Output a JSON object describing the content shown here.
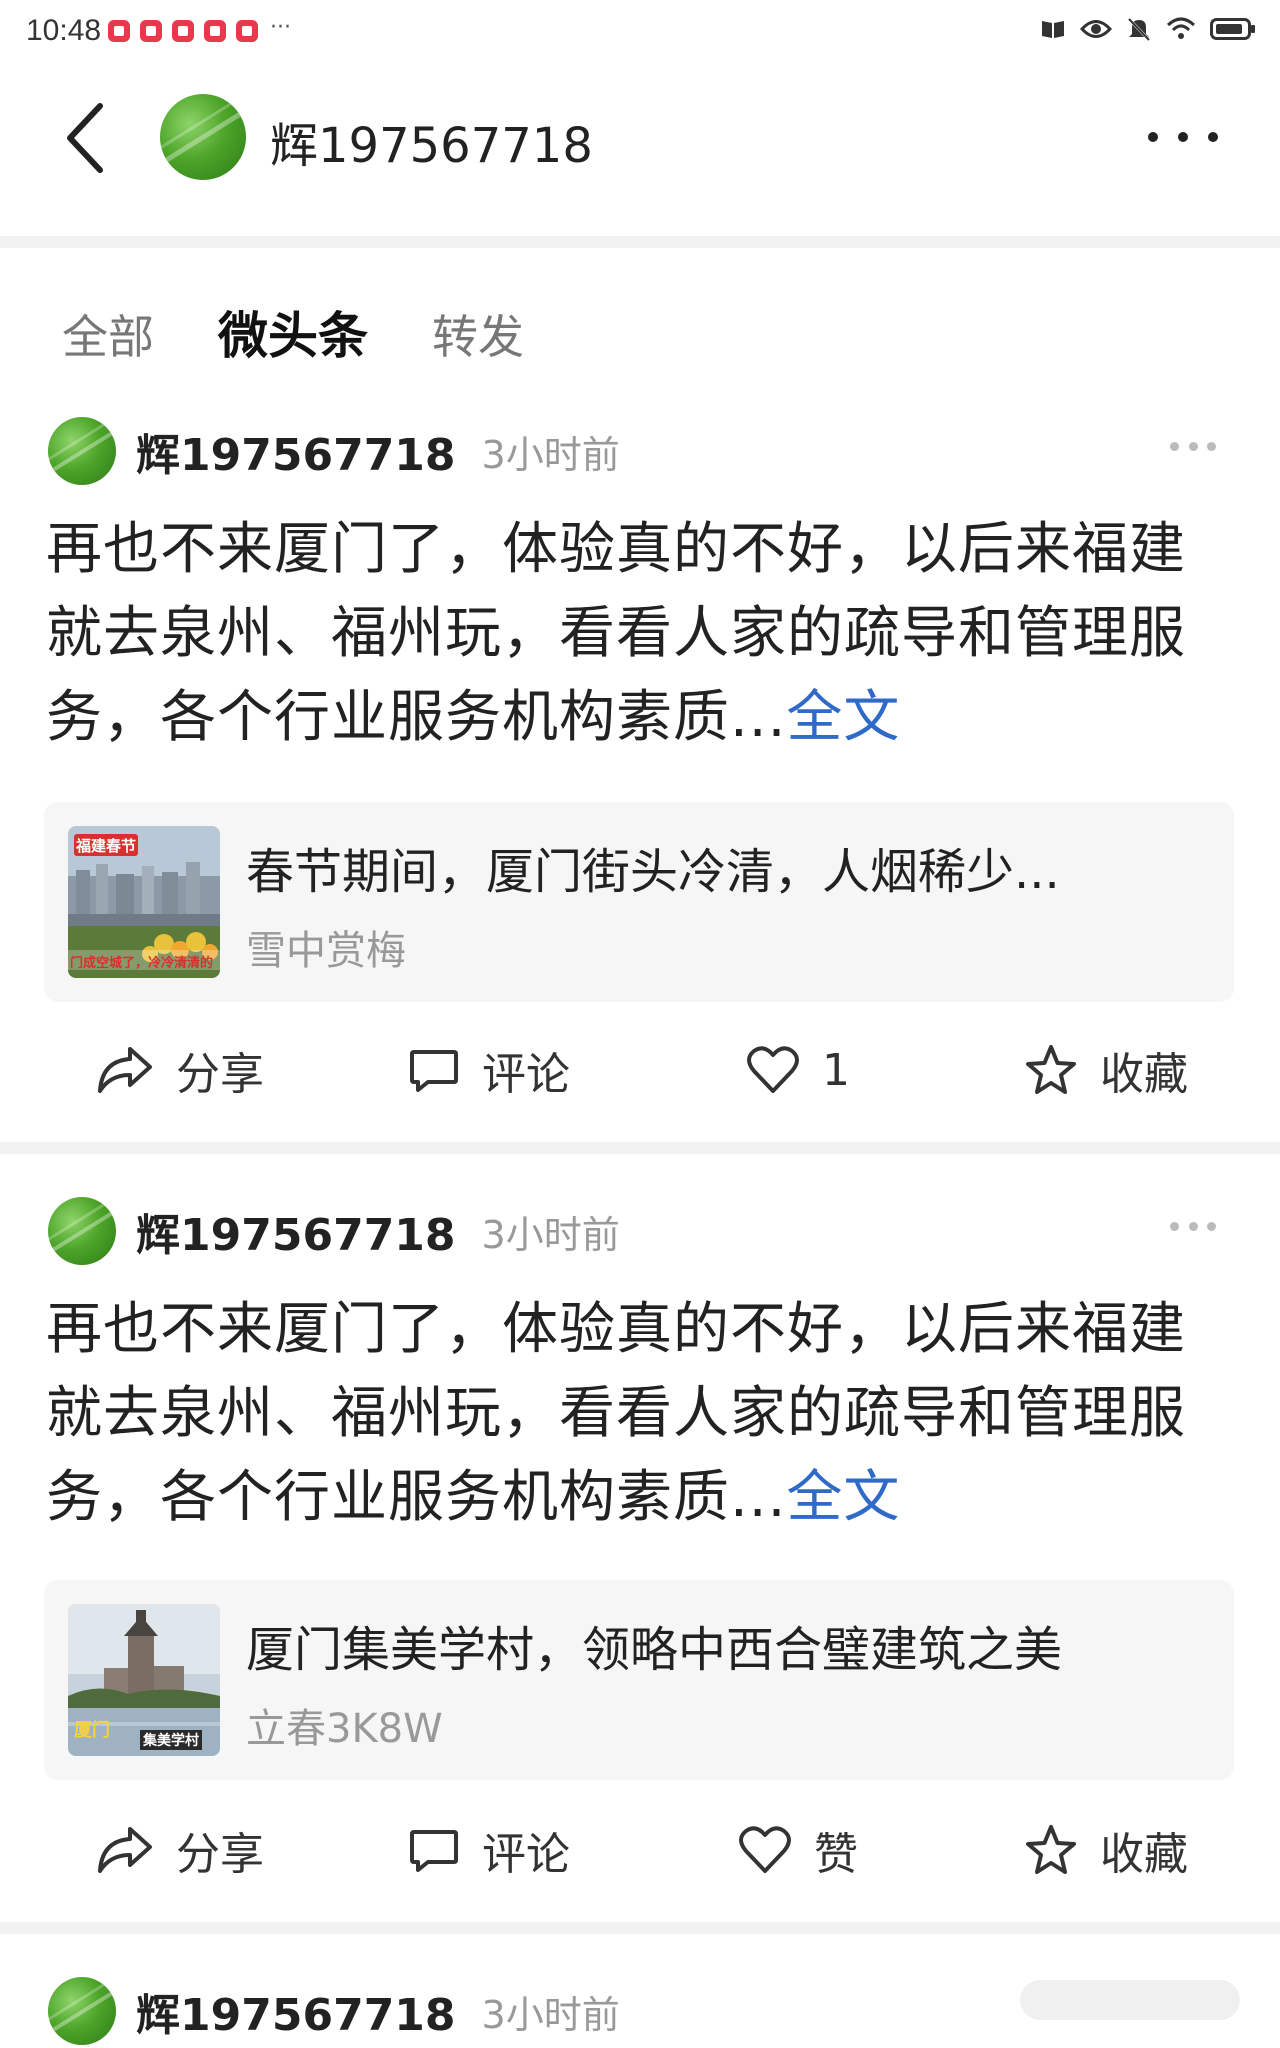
{
  "status_bar": {
    "time": "10:48",
    "more": "···"
  },
  "header": {
    "title": "辉197567718"
  },
  "tabs": [
    {
      "label": "全部",
      "active": false
    },
    {
      "label": "微头条",
      "active": true
    },
    {
      "label": "转发",
      "active": false
    }
  ],
  "posts": [
    {
      "author": "辉197567718",
      "time": "3小时前",
      "text": "再也不来厦门了，体验真的不好，以后来福建就去泉州、福州玩，看看人家的疏导和管理服务，各个行业服务机构素质...",
      "fulltext_label": "全文",
      "card": {
        "title": "春节期间，厦门街头冷清，人烟稀少...",
        "source": "雪中赏梅",
        "thumb_top_tag": "福建春节",
        "thumb_bottom_text": "门成空城了，冷冷清清的"
      },
      "actions": {
        "share": "分享",
        "comment": "评论",
        "like": "1",
        "favorite": "收藏"
      }
    },
    {
      "author": "辉197567718",
      "time": "3小时前",
      "text": "再也不来厦门了，体验真的不好，以后来福建就去泉州、福州玩，看看人家的疏导和管理服务，各个行业服务机构素质...",
      "fulltext_label": "全文",
      "card": {
        "title": "厦门集美学村，领略中西合璧建筑之美",
        "source": "立春3K8W",
        "thumb_left_text": "厦门",
        "thumb_right_text": "集美学村"
      },
      "actions": {
        "share": "分享",
        "comment": "评论",
        "like": "赞",
        "favorite": "收藏"
      }
    },
    {
      "author": "辉197567718",
      "time": "3小时前"
    }
  ],
  "icons": {
    "back": "back-arrow-icon",
    "more": "more-dots-icon",
    "share": "share-arrow-icon",
    "comment": "comment-bubble-icon",
    "like": "heart-icon",
    "favorite": "star-icon"
  },
  "colors": {
    "link": "#2f6ac9",
    "muted": "#999999",
    "notif_red": "#e8384d",
    "avatar_green": "#4da529"
  }
}
